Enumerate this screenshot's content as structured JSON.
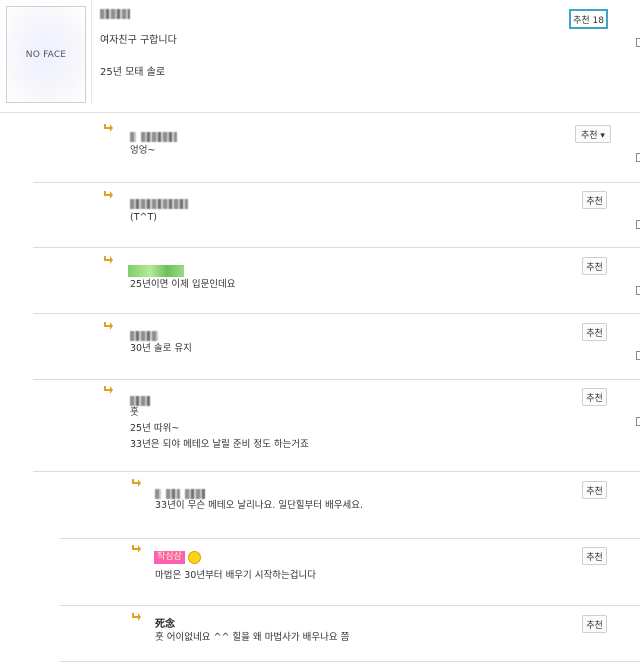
{
  "post": {
    "avatar_text": "NO FACE",
    "title": "여자친구 구합니다",
    "body": "25년 모태 솔로",
    "recommend_label": "추천 18"
  },
  "comments": [
    {
      "text": "엉엉~",
      "recommend_label": "추천 ▾"
    },
    {
      "text": "(T^T)",
      "recommend_label": "추천"
    },
    {
      "text": "25년이면 이제 입문인데요",
      "recommend_label": "추천"
    },
    {
      "text": "30년 솔로 유지",
      "recommend_label": "추천"
    },
    {
      "lines": [
        "훗",
        "25년 따위~",
        "33년은 되야 메테오 날릴 준비 정도 하는거죠"
      ],
      "recommend_label": "추천"
    },
    {
      "text": "33년이 무슨 메테오 날리나요. 일단힐부터 배우세요.",
      "recommend_label": "추천"
    },
    {
      "badge_text": "작심삼",
      "text": "마법은 30년부터 배우기 시작하는겁니다",
      "recommend_label": "추천"
    },
    {
      "nickname": "死念",
      "text": "훗 어이없네요 ^^ 힐을 왜 마법사가 배우나요 쯤",
      "recommend_label": "추천"
    }
  ],
  "icons": {
    "reply": "reply-arrow-icon",
    "smiley": "smiley-icon"
  },
  "colors": {
    "reply_arrow": "#e0a020",
    "recommend_highlight": "#3ba6c9",
    "badge_pink": "#ff5fb3",
    "badge_green": "#7fd06a"
  }
}
